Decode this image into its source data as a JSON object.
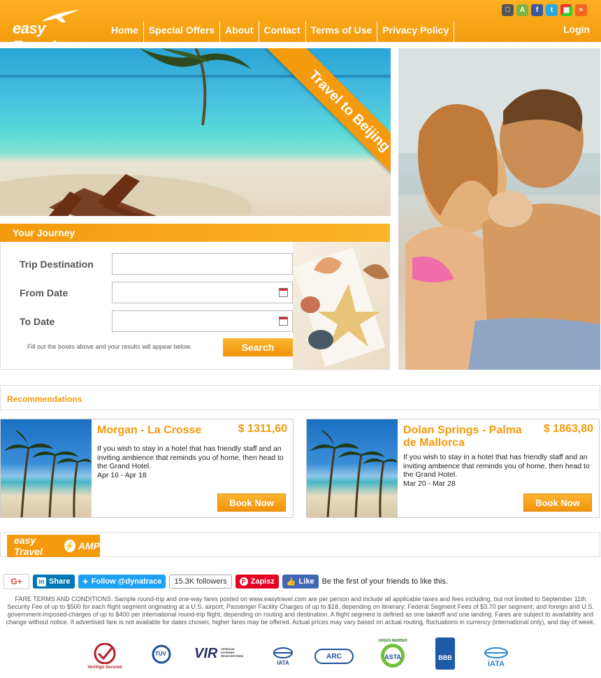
{
  "brand": {
    "name": "easy Travel"
  },
  "nav": {
    "items": [
      {
        "label": "Home"
      },
      {
        "label": "Special Offers"
      },
      {
        "label": "About"
      },
      {
        "label": "Contact"
      },
      {
        "label": "Terms of Use"
      },
      {
        "label": "Privacy Policy"
      }
    ],
    "login_label": "Login"
  },
  "social_top": [
    "apple-icon",
    "android-icon",
    "facebook-icon",
    "twitter-icon",
    "windows-icon",
    "rss-icon"
  ],
  "hero": {
    "ribbon": "Travel to Beijing"
  },
  "journey": {
    "title": "Your Journey",
    "destination_label": "Trip Destination",
    "from_label": "From Date",
    "to_label": "To Date",
    "destination_value": "",
    "from_value": "",
    "to_value": "",
    "hint": "Fill out the boxes above and your results will appear below.",
    "search_label": "Search"
  },
  "recommendations": {
    "title": "Recommendations",
    "cards": [
      {
        "title": "Morgan - La Crosse",
        "price": "$ 1311,60",
        "description": "If you wish to stay in a hotel that has friendly staff and an inviting ambience that reminds you of home, then head to the Grand Hotel.",
        "dates": "Apr 16 - Apr 18",
        "button": "Book Now"
      },
      {
        "title": "Dolan Springs - Palma de Mallorca",
        "price": "$ 1863,80",
        "description": "If you wish to stay in a hotel that has friendly staff and an inviting ambience that reminds you of home, then head to the Grand Hotel.",
        "dates": "Mar 20 - Mar 28",
        "button": "Book Now"
      }
    ]
  },
  "amp": {
    "brand": "easy Travel",
    "suffix": "AMP"
  },
  "social_bottom": {
    "gplus": "G+",
    "linkedin": "Share",
    "twitter": "Follow @dynatrace",
    "followers": "15.3K followers",
    "pinterest": "Zapisz",
    "facebook": "Like",
    "facebook_text": "Be the first of your friends to like this."
  },
  "fare_terms": "FARE TERMS AND CONDITIONS: Sample round-trip and one-way fares posted on www.easytravel.com are per person and include all applicable taxes and fees including, but not limited to September 11th Security Fee of up to $500 for each flight segment originating at a U.S. airport; Passenger Facility Charges of up to $18, depending on itinerary; Federal Segment Fees of $3.70 per segment; and foreign and U.S. government-imposed-charges of up to $400 per international round-trip flight, depending on routing and destination. A flight segment is defined as one takeoff and one landing. Fares are subject to availability and change without notice. If advertised fare is not available for dates chosen, higher fares may be offered. Actual prices may vary based on actual routing, fluctuations in currency (international only), and day of week.",
  "badges": {
    "verisign": "VeriSign Secured",
    "tuv": "TÜV",
    "vir": "VIR",
    "vir_sub": "VERBAND INTERNET REISEVERTRIEB",
    "iata": "IATA",
    "arc": "ARC",
    "asta": "ASTA",
    "asta_top": "GREEN MEMBER",
    "bbb": "BBB",
    "iata2": "IATA"
  }
}
